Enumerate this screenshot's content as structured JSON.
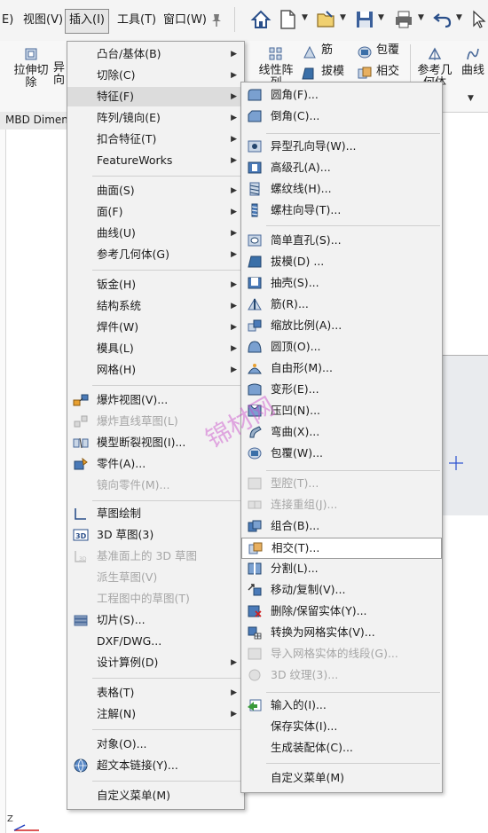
{
  "menubar": {
    "items": [
      {
        "label": "E)"
      },
      {
        "label": "视图(V)"
      },
      {
        "label": "插入(I)"
      },
      {
        "label": "工具(T)"
      },
      {
        "label": "窗口(W)"
      }
    ]
  },
  "ribbon": {
    "tools": [
      {
        "label": "拉伸切\n除"
      },
      {
        "label": "异\n向"
      },
      {
        "label": "线性阵\n列"
      },
      {
        "label": "参考几\n何体"
      },
      {
        "label": "曲线"
      }
    ],
    "side": [
      {
        "label": "筋"
      },
      {
        "label": "拔模"
      },
      {
        "label": "包覆"
      },
      {
        "label": "相交"
      }
    ]
  },
  "tab": {
    "label": "MBD Dimens"
  },
  "insert_menu": {
    "items": [
      {
        "label": "凸台/基体(B)",
        "submenu": true
      },
      {
        "label": "切除(C)",
        "submenu": true
      },
      {
        "label": "特征(F)",
        "submenu": true
      },
      {
        "label": "阵列/镜向(E)",
        "submenu": true
      },
      {
        "label": "扣合特征(T)",
        "submenu": true
      },
      {
        "label": "FeatureWorks",
        "submenu": true
      },
      {
        "label": "曲面(S)",
        "submenu": true
      },
      {
        "label": "面(F)",
        "submenu": true
      },
      {
        "label": "曲线(U)",
        "submenu": true
      },
      {
        "label": "参考几何体(G)",
        "submenu": true
      },
      {
        "label": "钣金(H)",
        "submenu": true
      },
      {
        "label": "结构系统",
        "submenu": true
      },
      {
        "label": "焊件(W)",
        "submenu": true
      },
      {
        "label": "模具(L)",
        "submenu": true
      },
      {
        "label": "网格(H)",
        "submenu": true
      },
      {
        "label": "爆炸视图(V)..."
      },
      {
        "label": "爆炸直线草图(L)"
      },
      {
        "label": "模型断裂视图(I)..."
      },
      {
        "label": "零件(A)..."
      },
      {
        "label": "镜向零件(M)..."
      },
      {
        "label": "草图绘制"
      },
      {
        "label": "3D 草图(3)"
      },
      {
        "label": "基准面上的 3D 草图"
      },
      {
        "label": "派生草图(V)"
      },
      {
        "label": "工程图中的草图(T)"
      },
      {
        "label": "切片(S)..."
      },
      {
        "label": "DXF/DWG..."
      },
      {
        "label": "设计算例(D)",
        "submenu": true
      },
      {
        "label": "表格(T)",
        "submenu": true
      },
      {
        "label": "注解(N)",
        "submenu": true
      },
      {
        "label": "对象(O)..."
      },
      {
        "label": "超文本链接(Y)..."
      },
      {
        "label": "自定义菜单(M)"
      }
    ]
  },
  "feature_menu": {
    "items": [
      {
        "label": "圆角(F)..."
      },
      {
        "label": "倒角(C)..."
      },
      {
        "label": "异型孔向导(W)..."
      },
      {
        "label": "高级孔(A)..."
      },
      {
        "label": "螺纹线(H)..."
      },
      {
        "label": "螺柱向导(T)..."
      },
      {
        "label": "简单直孔(S)..."
      },
      {
        "label": "拔模(D) ..."
      },
      {
        "label": "抽壳(S)..."
      },
      {
        "label": "筋(R)..."
      },
      {
        "label": "缩放比例(A)..."
      },
      {
        "label": "圆顶(O)..."
      },
      {
        "label": "自由形(M)..."
      },
      {
        "label": "变形(E)..."
      },
      {
        "label": "压凹(N)..."
      },
      {
        "label": "弯曲(X)..."
      },
      {
        "label": "包覆(W)..."
      },
      {
        "label": "型腔(T)..."
      },
      {
        "label": "连接重组(J)..."
      },
      {
        "label": "组合(B)..."
      },
      {
        "label": "相交(T)..."
      },
      {
        "label": "分割(L)..."
      },
      {
        "label": "移动/复制(V)..."
      },
      {
        "label": "删除/保留实体(Y)..."
      },
      {
        "label": "转换为网格实体(V)..."
      },
      {
        "label": "导入网格实体的线段(G)..."
      },
      {
        "label": "3D 纹理(3)..."
      },
      {
        "label": "输入的(I)..."
      },
      {
        "label": "保存实体(I)..."
      },
      {
        "label": "生成装配体(C)..."
      },
      {
        "label": "自定义菜单(M)"
      }
    ]
  },
  "watermark": {
    "text": "锦材网"
  },
  "axis": {
    "label": "Z"
  }
}
